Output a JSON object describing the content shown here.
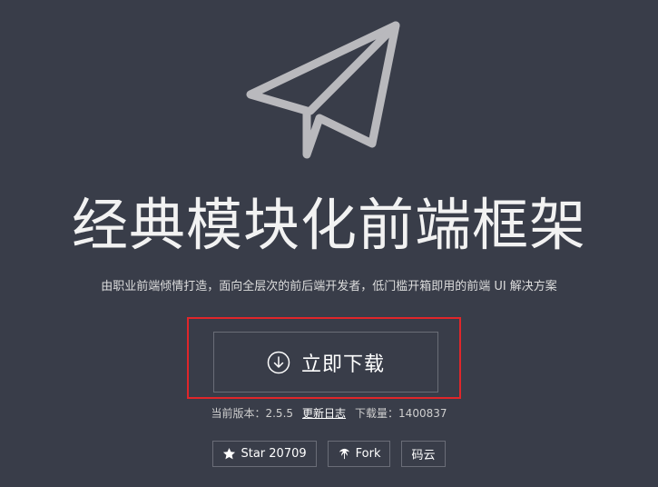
{
  "hero": {
    "title": "经典模块化前端框架",
    "subtitle": "由职业前端倾情打造，面向全层次的前后端开发者，低门槛开箱即用的前端 UI 解决方案"
  },
  "download": {
    "label": "立即下载"
  },
  "version_info": {
    "version_label": "当前版本：2.5.5",
    "changelog_label": "更新日志",
    "downloads_label": "下载量：1400837"
  },
  "repo_buttons": {
    "star_label": "Star 20709",
    "fork_label": "Fork",
    "gitee_label": "码云"
  },
  "colors": {
    "background": "#393d49",
    "highlight": "#e0262a",
    "border": "#6a6d77"
  },
  "icons": [
    "paper-plane-icon",
    "download-circle-icon",
    "star-icon",
    "fork-icon"
  ]
}
